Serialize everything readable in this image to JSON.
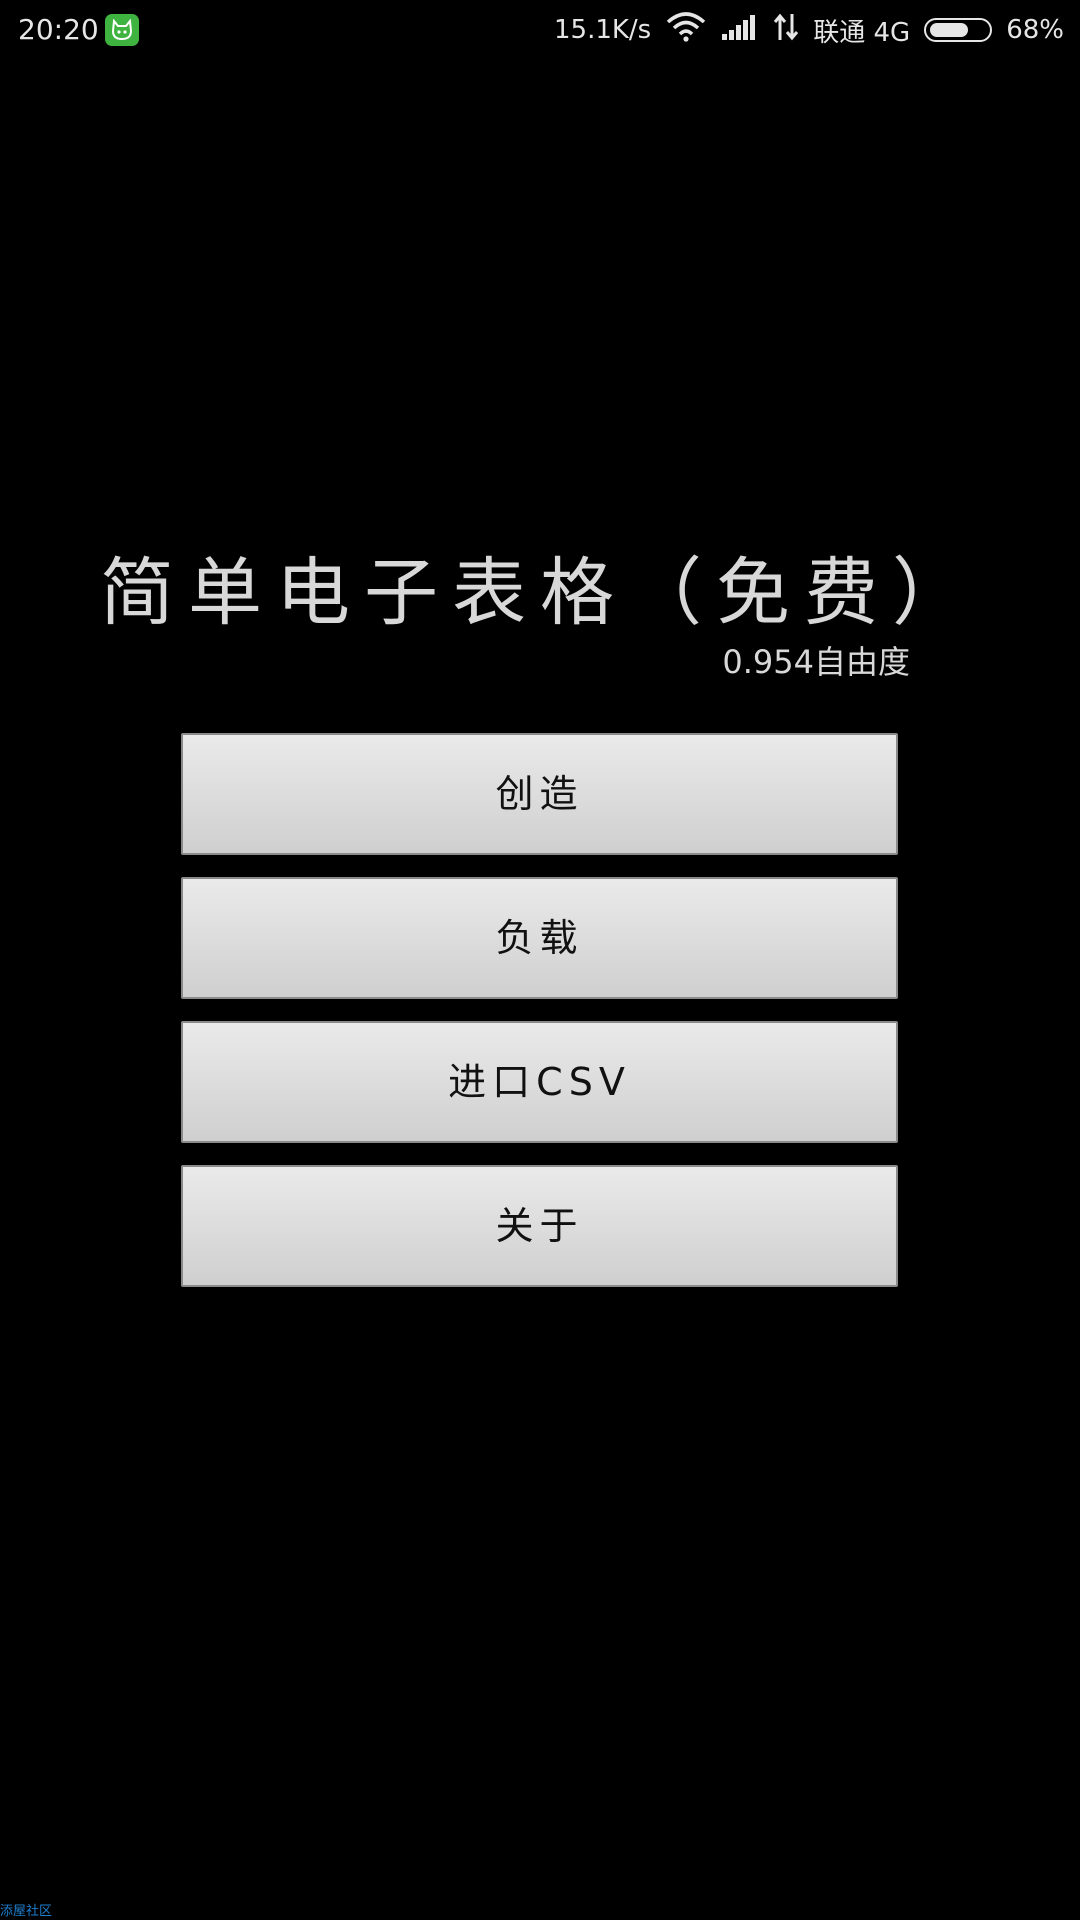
{
  "status_bar": {
    "time": "20:20",
    "app_icon": "android-cat-icon",
    "net_speed": "15.1K/s",
    "wifi_icon": "wifi-icon",
    "signal_icon": "signal-bars-icon",
    "data_icon": "data-arrows-icon",
    "carrier": "联通 4G",
    "battery_percent": "68%",
    "battery_level": 0.68
  },
  "app": {
    "title": "简单电子表格（免费）",
    "version": "0.954自由度"
  },
  "menu": {
    "buttons": [
      {
        "label": "创造"
      },
      {
        "label": "负载"
      },
      {
        "label": "进口CSV"
      },
      {
        "label": "关于"
      }
    ]
  },
  "watermark": "添屋社区",
  "colors": {
    "background": "#000000",
    "button_face": "#dedede",
    "button_text": "#111111",
    "title_text": "#d8d8d8",
    "watermark": "#1e7fd0"
  }
}
